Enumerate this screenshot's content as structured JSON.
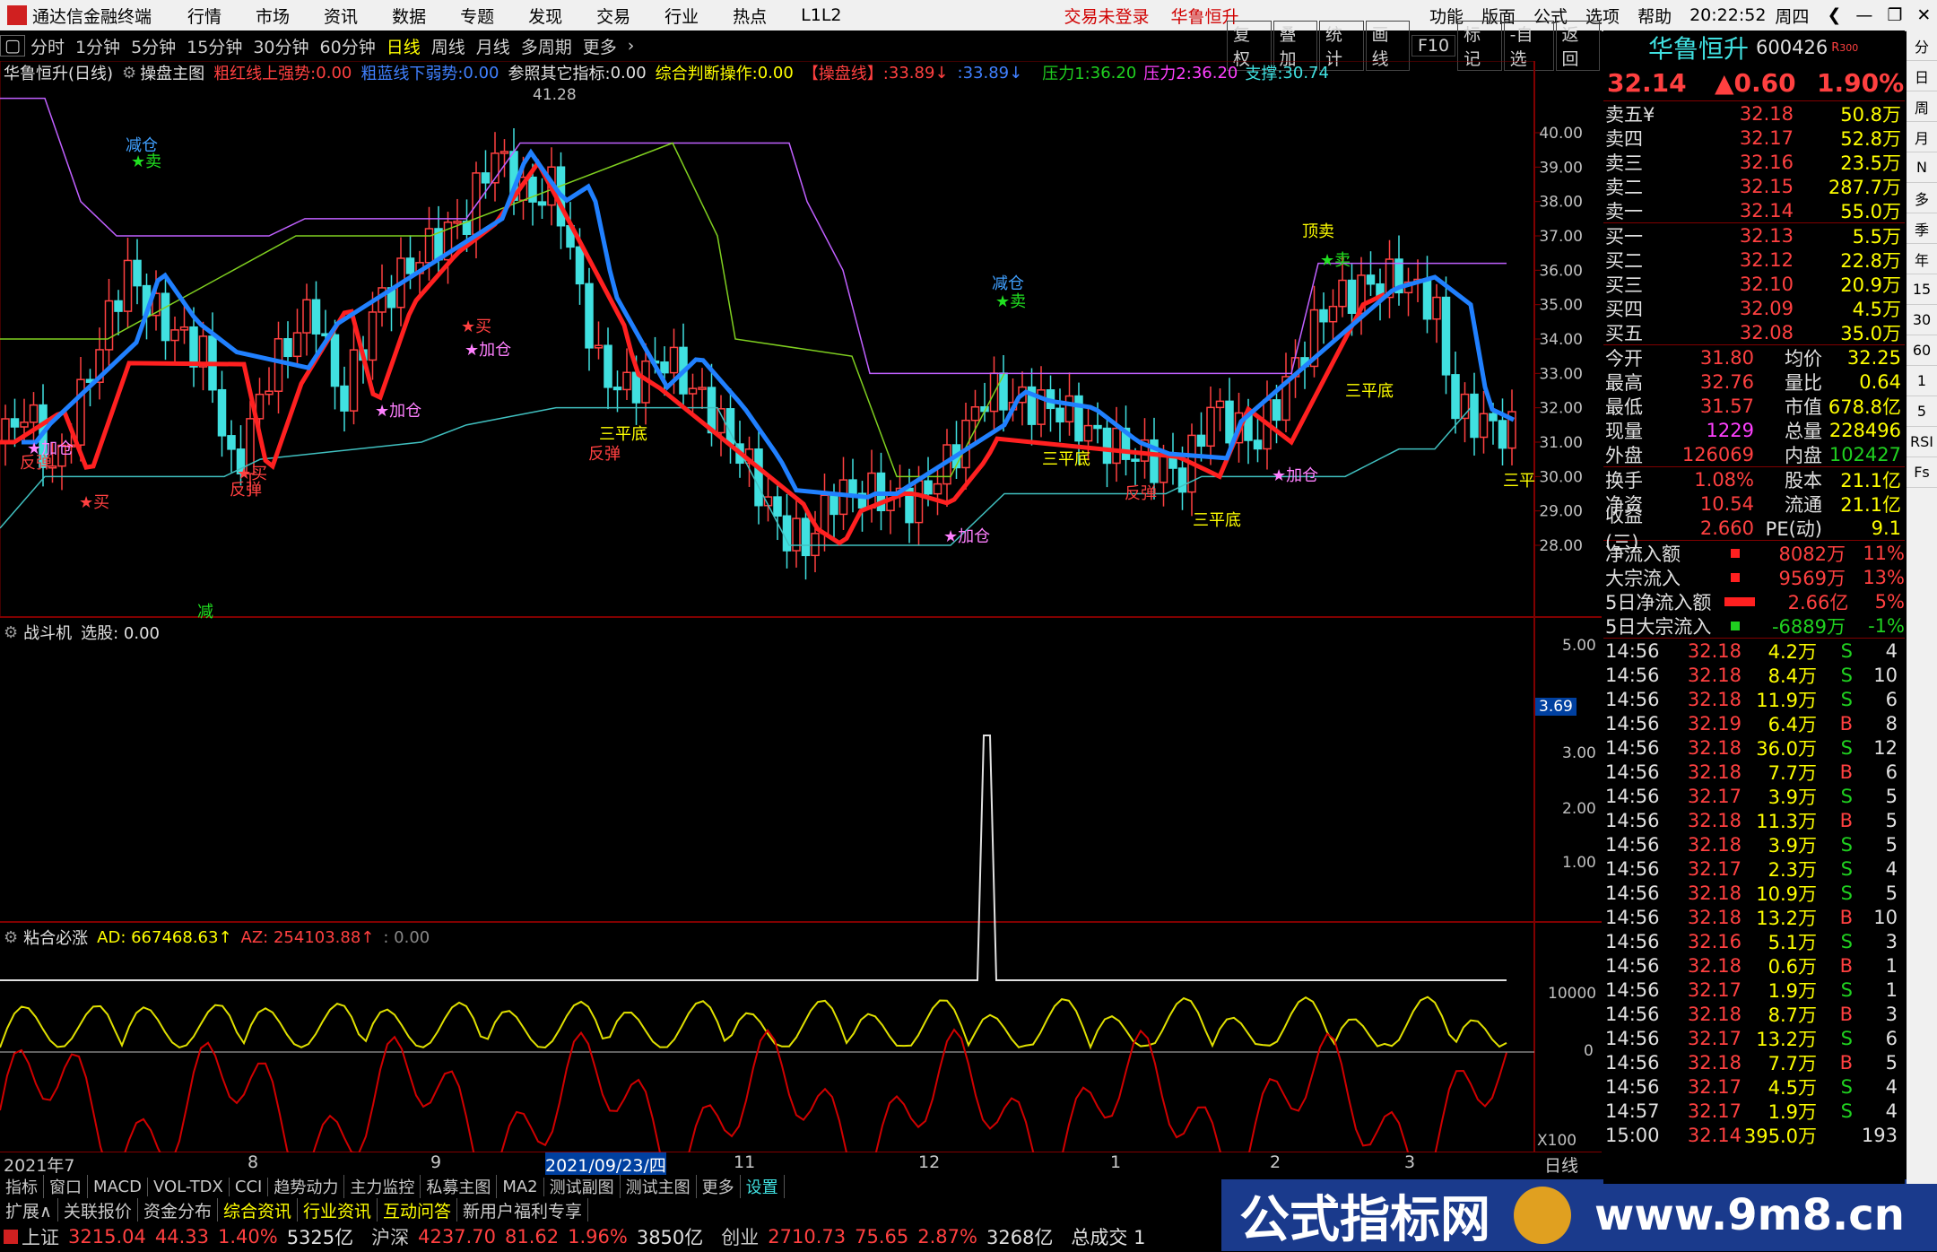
{
  "titlebar": {
    "app": "通达信金融终端",
    "menu": [
      "行情",
      "市场",
      "资讯",
      "数据",
      "专题",
      "发现",
      "交易",
      "行业",
      "热点",
      "L1L2"
    ],
    "login": "交易未登录",
    "stock_name": "华鲁恒升",
    "right_menu": [
      "功能",
      "版面",
      "公式",
      "选项",
      "帮助"
    ],
    "time": "20:22:52",
    "weekday": "周四"
  },
  "toolbar": {
    "periods": [
      "分时",
      "1分钟",
      "5分钟",
      "15分钟",
      "30分钟",
      "60分钟",
      "日线",
      "周线",
      "月线",
      "多周期",
      "更多"
    ],
    "active": "日线",
    "buttons": [
      "复权",
      "叠加",
      "统计",
      "画线",
      "F10",
      "标记",
      "-自选",
      "返回"
    ]
  },
  "chart_header": {
    "name": "华鲁恒升(日线)",
    "formula": "操盘主图",
    "items": [
      {
        "label": "粗红线上强势:",
        "value": "0.00",
        "color": "#ff4040"
      },
      {
        "label": "粗蓝线下弱势:",
        "value": "0.00",
        "color": "#4080ff"
      },
      {
        "label": "参照其它指标:",
        "value": "0.00",
        "color": "#e0e0e0"
      },
      {
        "label": "综合判断操作:",
        "value": "0.00",
        "color": "#ffff00"
      },
      {
        "label": "【操盘线】:",
        "value": "33.89↓",
        "color": "#ff4040"
      },
      {
        "label": ":",
        "value": "33.89↓",
        "color": "#4080ff"
      },
      {
        "label": "压力1:",
        "value": "36.20",
        "color": "#20d020"
      },
      {
        "label": "压力2:",
        "value": "36.20",
        "color": "#ff40ff"
      },
      {
        "label": "支撑:",
        "value": "30.74",
        "color": "#40e0e0"
      }
    ],
    "high_label": "41.28"
  },
  "price_axis": [
    "40.00",
    "39.00",
    "38.00",
    "37.00",
    "36.00",
    "35.00",
    "34.00",
    "33.00",
    "32.00",
    "31.00",
    "30.00",
    "29.00",
    "28.00"
  ],
  "signals": {
    "sell1": "减仓",
    "sell1b": "★卖",
    "sell2": "减仓",
    "sell2b": "★卖",
    "sell3": "顶卖",
    "sell3b": "★卖",
    "buy": "★买",
    "add": "★加仓",
    "rebound": "反弹",
    "three_bottom": "三平底",
    "three": "三平",
    "reduce": "减"
  },
  "sub1": {
    "name": "战斗机",
    "items": "选股: 0.00",
    "axis": [
      "5.00",
      "3.00",
      "2.00",
      "1.00"
    ],
    "cur": "3.69"
  },
  "sub2": {
    "name": "粘合必涨",
    "ad": "AD: 667468.63↑",
    "az": "AZ: 254103.88↑",
    "other": ": 0.00",
    "axis": [
      "10000",
      "0"
    ],
    "x100": "X100"
  },
  "dates": [
    "2021年7",
    "8",
    "9",
    "2021/09/23/四",
    "11",
    "12",
    "1",
    "2",
    "3"
  ],
  "period_label": "日线",
  "tabs": [
    "指标",
    "窗口",
    "MACD",
    "VOL-TDX",
    "CCI",
    "趋势动力",
    "主力监控",
    "私募主图",
    "MA2",
    "测试副图",
    "测试主图",
    "更多",
    "设置"
  ],
  "ext": [
    "扩展∧",
    "关联报价",
    "资金分布",
    "综合资讯",
    "行业资讯",
    "互动问答",
    "新用户福利专享"
  ],
  "quote": {
    "name": "华鲁恒升",
    "code": "600426",
    "suffix": "R",
    "suffix2": "300",
    "price": "32.14",
    "change": "▲0.60",
    "pct": "1.90%",
    "asks": [
      [
        "卖五¥",
        "32.18",
        "50.8万"
      ],
      [
        "卖四",
        "32.17",
        "52.8万"
      ],
      [
        "卖三",
        "32.16",
        "23.5万"
      ],
      [
        "卖二",
        "32.15",
        "287.7万"
      ],
      [
        "卖一",
        "32.14",
        "55.0万"
      ]
    ],
    "bids": [
      [
        "买一",
        "32.13",
        "5.5万"
      ],
      [
        "买二",
        "32.12",
        "22.8万"
      ],
      [
        "买三",
        "32.10",
        "20.9万"
      ],
      [
        "买四",
        "32.09",
        "4.5万"
      ],
      [
        "买五",
        "32.08",
        "35.0万"
      ]
    ],
    "stats": [
      [
        "今开",
        "31.80",
        "均价",
        "32.25"
      ],
      [
        "最高",
        "32.76",
        "量比",
        "0.64"
      ],
      [
        "最低",
        "31.57",
        "市值",
        "678.8亿"
      ],
      [
        "现量",
        "1229",
        "总量",
        "228496"
      ],
      [
        "外盘",
        "126069",
        "内盘",
        "102427"
      ],
      [
        "换手",
        "1.08%",
        "股本",
        "21.1亿"
      ],
      [
        "净资",
        "10.54",
        "流通",
        "21.1亿"
      ],
      [
        "收益(三)",
        "2.660",
        "PE(动)",
        "9.1"
      ]
    ],
    "flows": [
      [
        "净流入额",
        "8082万",
        "11%"
      ],
      [
        "大宗流入",
        "9569万",
        "13%"
      ],
      [
        "5日净流入额",
        "2.66亿",
        "5%"
      ],
      [
        "5日大宗流入",
        "-6889万",
        "-1%"
      ]
    ],
    "ticks": [
      [
        "14:56",
        "32.18",
        "4.2万",
        "S",
        "4"
      ],
      [
        "14:56",
        "32.18",
        "8.4万",
        "S",
        "10"
      ],
      [
        "14:56",
        "32.18",
        "11.9万",
        "S",
        "6"
      ],
      [
        "14:56",
        "32.19",
        "6.4万",
        "B",
        "8"
      ],
      [
        "14:56",
        "32.18",
        "36.0万",
        "S",
        "12"
      ],
      [
        "14:56",
        "32.18",
        "7.7万",
        "B",
        "6"
      ],
      [
        "14:56",
        "32.17",
        "3.9万",
        "S",
        "5"
      ],
      [
        "14:56",
        "32.18",
        "11.3万",
        "B",
        "5"
      ],
      [
        "14:56",
        "32.18",
        "3.9万",
        "S",
        "5"
      ],
      [
        "14:56",
        "32.17",
        "2.3万",
        "S",
        "4"
      ],
      [
        "14:56",
        "32.18",
        "10.9万",
        "S",
        "5"
      ],
      [
        "14:56",
        "32.18",
        "13.2万",
        "B",
        "10"
      ],
      [
        "14:56",
        "32.16",
        "5.1万",
        "S",
        "3"
      ],
      [
        "14:56",
        "32.18",
        "0.6万",
        "B",
        "1"
      ],
      [
        "14:56",
        "32.17",
        "1.9万",
        "S",
        "1"
      ],
      [
        "14:56",
        "32.18",
        "8.7万",
        "B",
        "3"
      ],
      [
        "14:56",
        "32.17",
        "13.2万",
        "S",
        "6"
      ],
      [
        "14:56",
        "32.18",
        "7.7万",
        "B",
        "5"
      ],
      [
        "14:56",
        "32.17",
        "4.5万",
        "S",
        "4"
      ],
      [
        "14:57",
        "32.17",
        "1.9万",
        "S",
        "4"
      ],
      [
        "15:00",
        "32.14",
        "395.0万",
        "",
        "193"
      ]
    ]
  },
  "sidebar": [
    "分",
    "日",
    "周",
    "月",
    "N",
    "多",
    "季",
    "年",
    "15",
    "30",
    "60",
    "1",
    "5",
    "RSI",
    "Fs"
  ],
  "status": [
    {
      "label": "上证",
      "v": "3215.04",
      "c": "44.33",
      "p": "1.40%",
      "a": "5325亿"
    },
    {
      "label": "沪深",
      "v": "4237.70",
      "c": "81.62",
      "p": "1.96%",
      "a": "3850亿"
    },
    {
      "label": "创业",
      "v": "2710.73",
      "c": "75.65",
      "p": "2.87%",
      "a": "3268亿"
    }
  ],
  "status_tail": "总成交 1",
  "watermark": {
    "text": "公式指标网",
    "url": "www.9m8.cn"
  },
  "colors": {
    "up": "#ff4040",
    "down": "#40e0e0",
    "red_line": "#ff2020",
    "blue_line": "#2080ff"
  }
}
